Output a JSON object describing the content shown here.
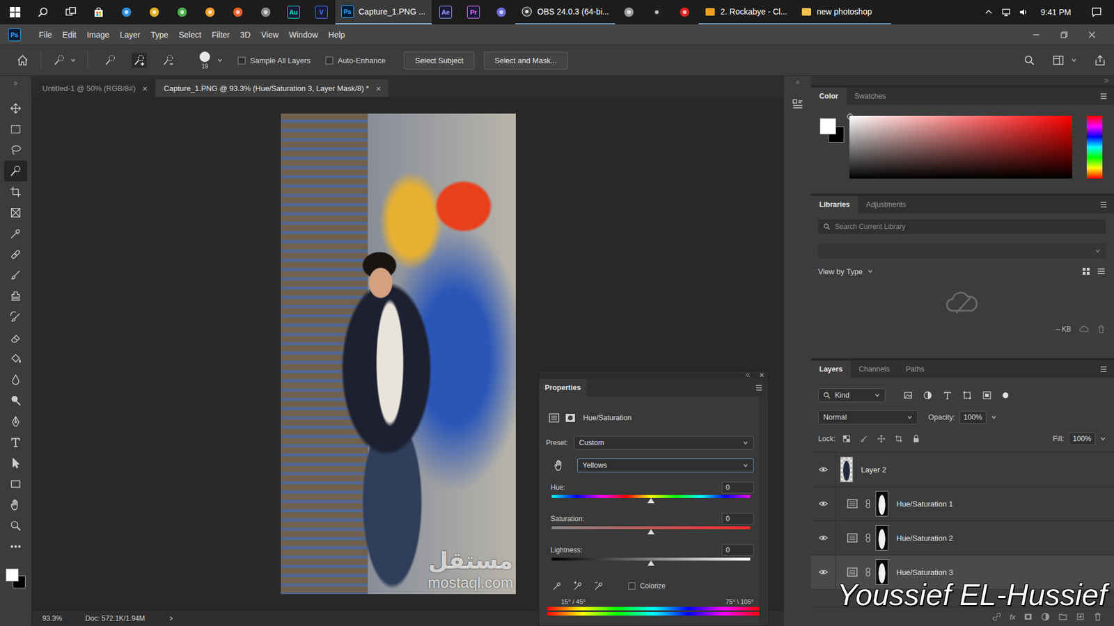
{
  "taskbar": {
    "app_badges": [
      {
        "label": "Au",
        "color": "#00e4bb"
      },
      {
        "label": "V",
        "color": "#4a7dff"
      }
    ],
    "windows": [
      {
        "label": "Capture_1.PNG ...",
        "badge": "Ps",
        "selected": true
      },
      {
        "label": "OBS 24.0.3 (64-bi...",
        "selected": false
      },
      {
        "label": "2. Rockabye - Cl...",
        "selected": false
      },
      {
        "label": "new photoshop",
        "selected": false
      }
    ],
    "more_badges": [
      {
        "label": "Ae",
        "color": "#9999ff"
      },
      {
        "label": "Pr",
        "color": "#ea77ff"
      }
    ],
    "clock": "9:41 PM"
  },
  "menu": {
    "logo": "Ps",
    "items": [
      "File",
      "Edit",
      "Image",
      "Layer",
      "Type",
      "Select",
      "Filter",
      "3D",
      "View",
      "Window",
      "Help"
    ]
  },
  "options": {
    "brush_size": "19",
    "checkboxes": [
      {
        "label": "Sample All Layers",
        "checked": false
      },
      {
        "label": "Auto-Enhance",
        "checked": false
      }
    ],
    "buttons": [
      "Select Subject",
      "Select and Mask..."
    ]
  },
  "doc_tabs": [
    {
      "label": "Untitled-1 @ 50% (RGB/8#)",
      "selected": false,
      "close": "×"
    },
    {
      "label": "Capture_1.PNG @ 93.3% (Hue/Saturation 3, Layer Mask/8) *",
      "selected": true,
      "close": "×"
    }
  ],
  "tools": [
    {
      "kind": "move",
      "selected": false
    },
    {
      "kind": "marquee",
      "selected": false
    },
    {
      "kind": "lasso",
      "selected": false
    },
    {
      "kind": "quickselect",
      "selected": true
    },
    {
      "kind": "crop",
      "selected": false
    },
    {
      "kind": "frame",
      "selected": false
    },
    {
      "kind": "eyedropper",
      "selected": false
    },
    {
      "kind": "healing",
      "selected": false
    },
    {
      "kind": "brush",
      "selected": false
    },
    {
      "kind": "stamp",
      "selected": false
    },
    {
      "kind": "historybrush",
      "selected": false
    },
    {
      "kind": "eraser",
      "selected": false
    },
    {
      "kind": "bucket",
      "selected": false
    },
    {
      "kind": "blur",
      "selected": false
    },
    {
      "kind": "dodge",
      "selected": false
    },
    {
      "kind": "pen",
      "selected": false
    },
    {
      "kind": "type",
      "selected": false
    },
    {
      "kind": "pathselect",
      "selected": false
    },
    {
      "kind": "rectangle",
      "selected": false
    },
    {
      "kind": "hand",
      "selected": false
    },
    {
      "kind": "zoom",
      "selected": false
    },
    {
      "kind": "more",
      "selected": false
    }
  ],
  "status_bar": {
    "zoom": "93.3%",
    "doc": "Doc: 572.1K/1.94M"
  },
  "properties": {
    "tab": "Properties",
    "adjustment": "Hue/Saturation",
    "preset_label": "Preset:",
    "preset": "Custom",
    "range": "Yellows",
    "sliders": [
      {
        "label": "Hue:",
        "value": "0",
        "level": 0.5,
        "kind": "hue"
      },
      {
        "label": "Saturation:",
        "value": "0",
        "level": 0.5,
        "kind": "saturation"
      },
      {
        "label": "Lightness:",
        "value": "0",
        "level": 0.5,
        "kind": "lightness"
      }
    ],
    "colorize": {
      "label": "Colorize",
      "checked": false
    },
    "range_left": "15° / 45°",
    "range_right": "75° \\ 105°"
  },
  "color_panel": {
    "tabs": [
      {
        "label": "Color",
        "selected": true
      },
      {
        "label": "Swatches",
        "selected": false
      }
    ],
    "foreground": "#ffffff",
    "background": "#000000"
  },
  "libraries": {
    "tabs": [
      {
        "label": "Libraries",
        "selected": true
      },
      {
        "label": "Adjustments",
        "selected": false
      }
    ],
    "search_placeholder": "Search Current Library",
    "view": "View by Type",
    "storage": "– KB"
  },
  "layers": {
    "tabs": [
      {
        "label": "Layers",
        "selected": true
      },
      {
        "label": "Channels",
        "selected": false
      },
      {
        "label": "Paths",
        "selected": false
      }
    ],
    "filter": "Kind",
    "blend": "Normal",
    "opacity_label": "Opacity:",
    "opacity": "100%",
    "lock_label": "Lock:",
    "fill_label": "Fill:",
    "fill": "100%",
    "items": [
      {
        "name": "Layer 2",
        "kind": "pixel",
        "visible": true,
        "selected": false
      },
      {
        "name": "Hue/Saturation 1",
        "kind": "adjustment",
        "visible": true,
        "selected": false
      },
      {
        "name": "Hue/Saturation 2",
        "kind": "adjustment",
        "visible": true,
        "selected": false
      },
      {
        "name": "Hue/Saturation 3",
        "kind": "adjustment",
        "visible": true,
        "selected": true
      }
    ],
    "footer_fx": "fx"
  },
  "watermarks": {
    "site_logo": "مستقل",
    "site": "mostaql.com",
    "author": "Youssief EL-Hussief"
  }
}
